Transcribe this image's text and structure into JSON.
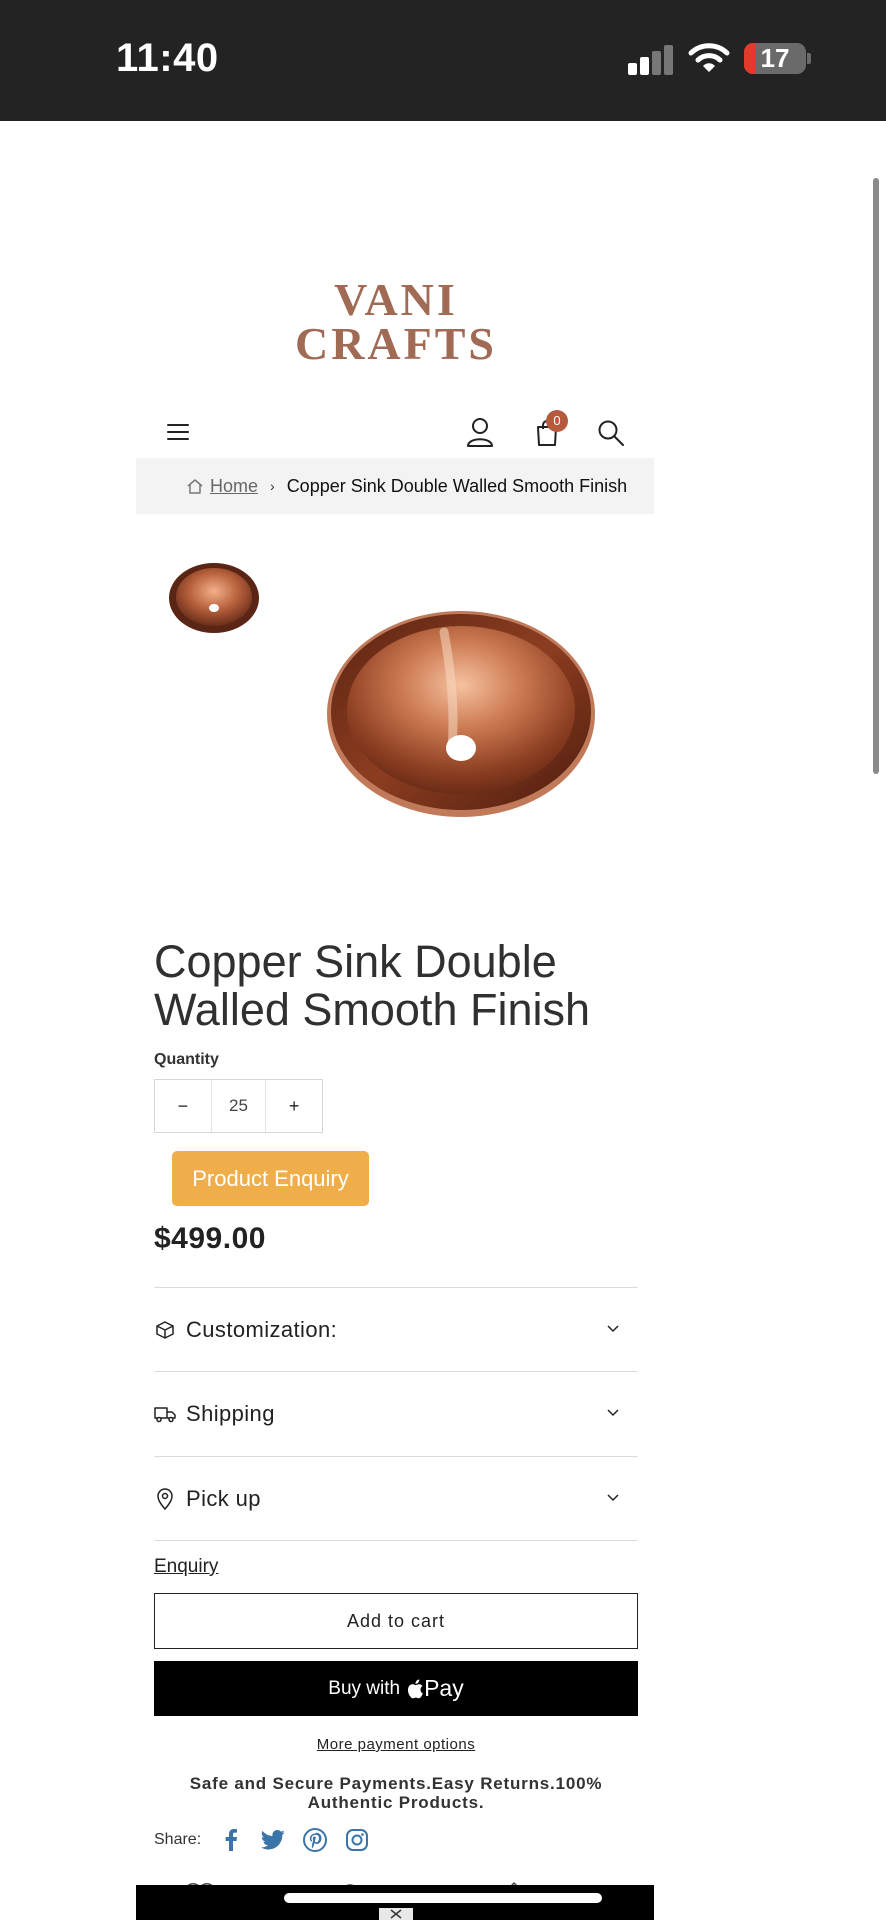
{
  "status_bar": {
    "time": "11:40",
    "battery": "17",
    "battery_fraction": 0.17
  },
  "brand": {
    "line1": "VANI",
    "line2": "CRAFTS"
  },
  "header": {
    "cart_count": "0"
  },
  "breadcrumb": {
    "home": "Home",
    "separator": "›",
    "current": "Copper Sink Double Walled Smooth Finish"
  },
  "product": {
    "title": "Copper Sink Double Walled Smooth Finish",
    "quantity_label": "Quantity",
    "quantity_value": "25",
    "minus": "−",
    "plus": "+",
    "enquiry_button": "Product Enquiry",
    "price": "$499.00"
  },
  "accordions": [
    {
      "label": "Customization:",
      "icon": "box-icon"
    },
    {
      "label": "Shipping",
      "icon": "truck-icon"
    },
    {
      "label": "Pick up",
      "icon": "map-pin-icon"
    }
  ],
  "actions": {
    "enquiry_link": "Enquiry",
    "add_to_cart": "Add to cart",
    "buy_with": "Buy with",
    "apple_pay": "Pay",
    "more_payment": "More payment options"
  },
  "trust_text": "Safe and Secure Payments.Easy Returns.100% Authentic Products.",
  "share": {
    "label": "Share:",
    "icons": [
      "facebook-icon",
      "twitter-icon",
      "pinterest-icon",
      "instagram-icon"
    ]
  },
  "colors": {
    "accent": "#efae4a",
    "copper": "#b86a45",
    "badge": "#b55a3c",
    "status_bar": "#232323"
  }
}
